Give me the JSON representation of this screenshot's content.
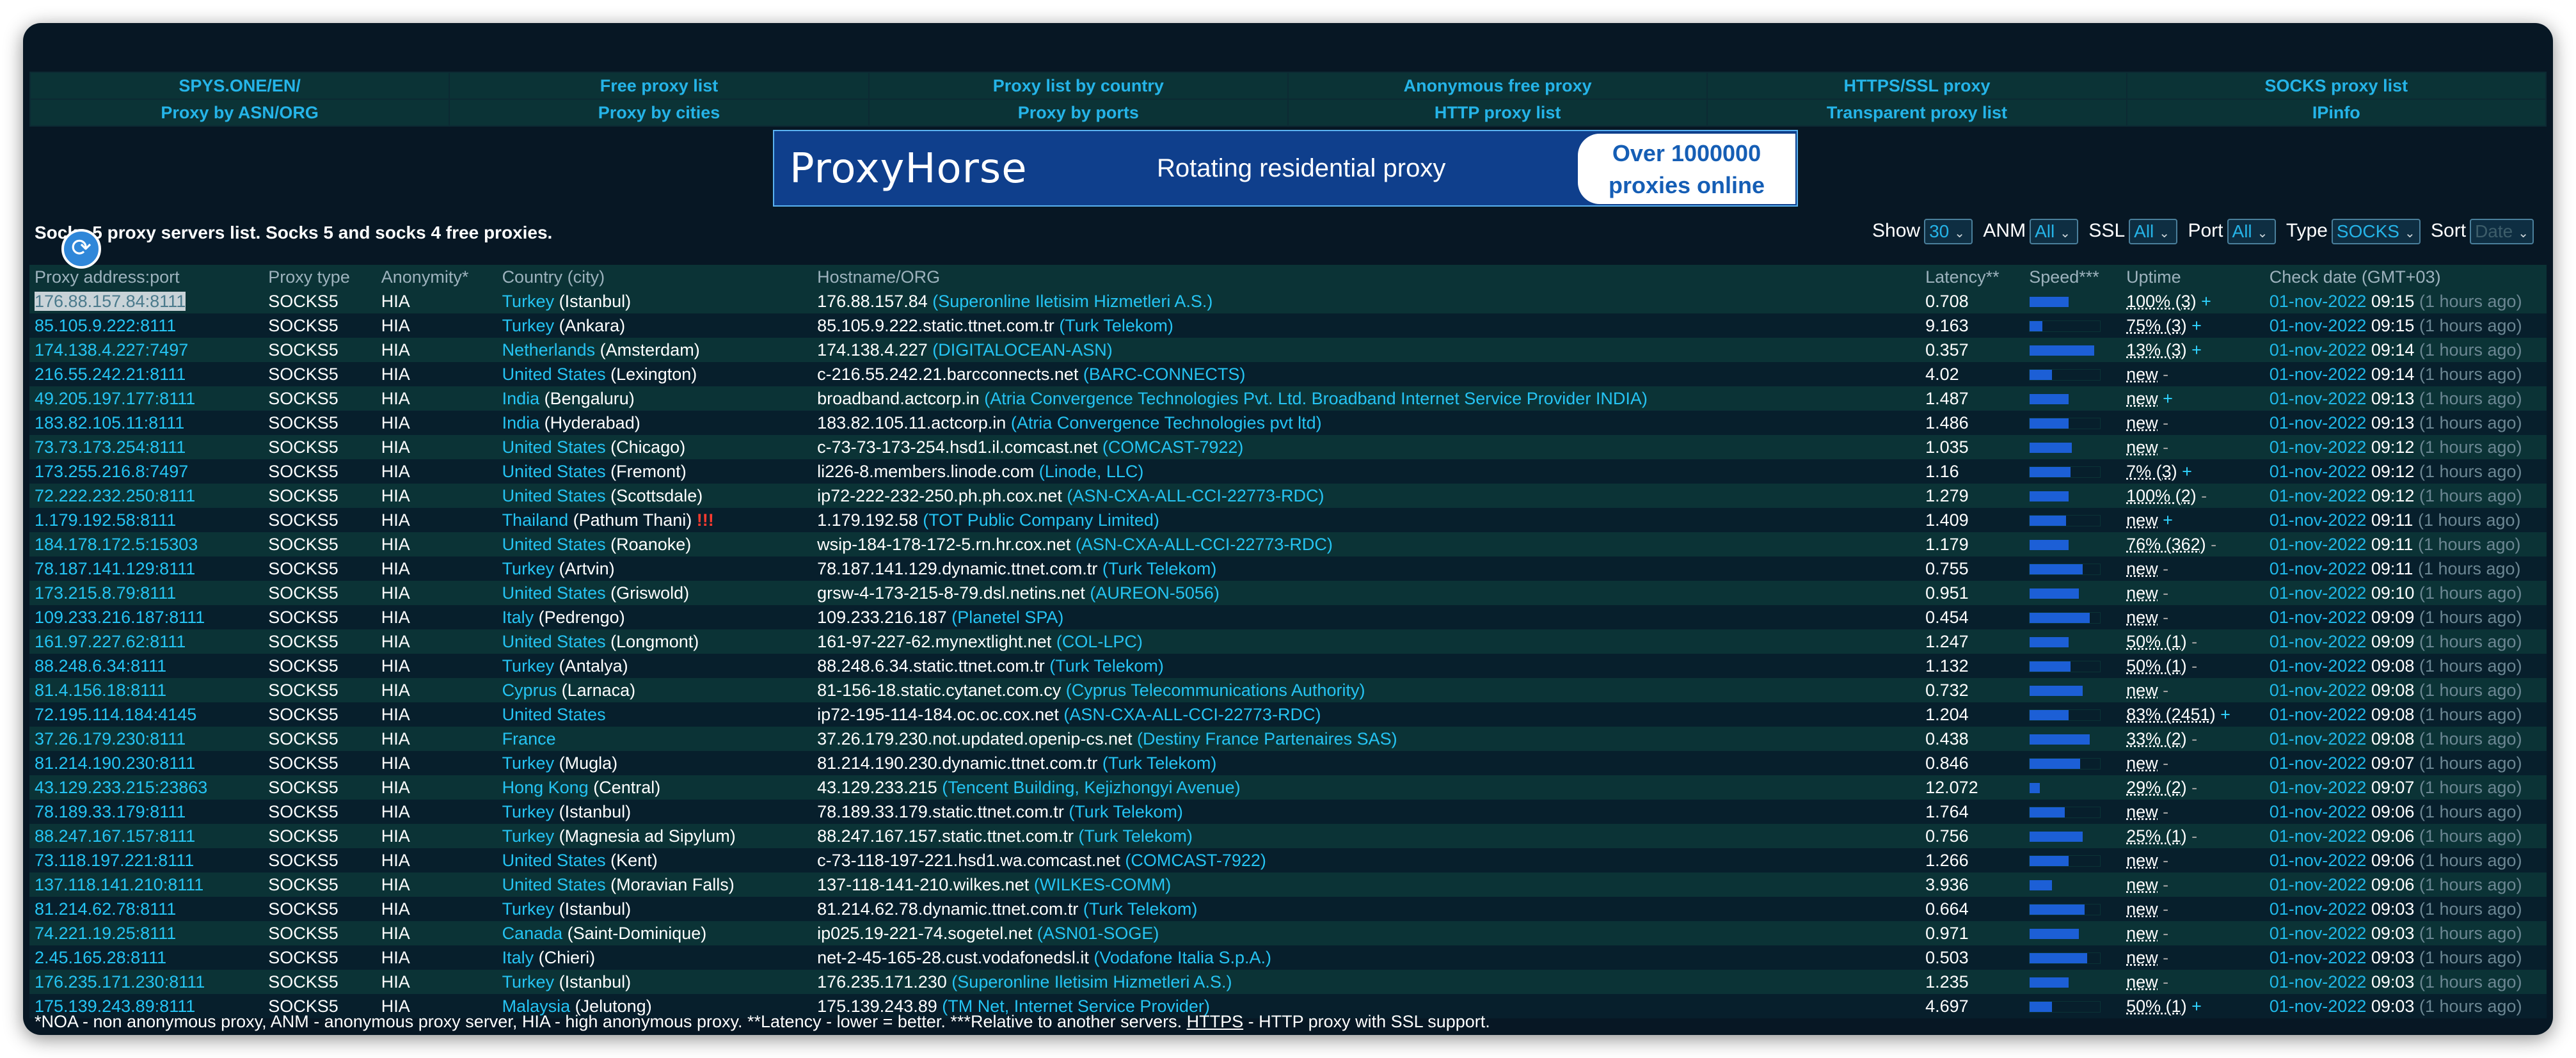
{
  "nav": {
    "row1": [
      "SPYS.ONE/EN/",
      "Free proxy list",
      "Proxy list by country",
      "Anonymous free proxy",
      "HTTPS/SSL proxy",
      "SOCKS proxy list"
    ],
    "row2": [
      "Proxy by ASN/ORG",
      "Proxy by cities",
      "Proxy by ports",
      "HTTP proxy list",
      "Transparent proxy list",
      "IPinfo"
    ]
  },
  "banner": {
    "brand": "ProxyHorse",
    "tagline": "Rotating residential proxy",
    "pill_line1": "Over 1000000",
    "pill_line2": "proxies online"
  },
  "info": {
    "title": "Socks 5 proxy servers list. Socks 5 and socks 4 free proxies."
  },
  "filters": {
    "show_label": "Show",
    "show_value": "30",
    "anm_label": "ANM",
    "anm_value": "All",
    "ssl_label": "SSL",
    "ssl_value": "All",
    "port_label": "Port",
    "port_value": "All",
    "type_label": "Type",
    "type_value": "SOCKS",
    "sort_label": "Sort",
    "sort_value": "Date"
  },
  "table": {
    "headers": [
      "Proxy address:port",
      "Proxy type",
      "Anonymity*",
      "Country (city)",
      "Hostname/ORG",
      "Latency**",
      "Speed***",
      "Uptime",
      "Check date (GMT+03)"
    ],
    "rows": [
      {
        "ip": "176.88.157.84:8111",
        "type": "SOCKS5",
        "anon": "HIA",
        "country": "Turkey",
        "city": "(Istanbul)",
        "host": "176.88.157.84",
        "org": "(Superonline Iletisim Hizmetleri A.S.)",
        "latency": "0.708",
        "speed": 0.55,
        "uptime": "100% (3)",
        "sign": "+",
        "date": "01-nov-2022",
        "time": "09:15",
        "ago": "(1 hours ago)"
      },
      {
        "ip": "85.105.9.222:8111",
        "type": "SOCKS5",
        "anon": "HIA",
        "country": "Turkey",
        "city": "(Ankara)",
        "host": "85.105.9.222.static.ttnet.com.tr",
        "org": "(Turk Telekom)",
        "latency": "9.163",
        "speed": 0.18,
        "uptime": "75% (3)",
        "sign": "+",
        "date": "01-nov-2022",
        "time": "09:15",
        "ago": "(1 hours ago)"
      },
      {
        "ip": "174.138.4.227:7497",
        "type": "SOCKS5",
        "anon": "HIA",
        "country": "Netherlands",
        "city": "(Amsterdam)",
        "host": "174.138.4.227",
        "org": "(DIGITALOCEAN-ASN)",
        "latency": "0.357",
        "speed": 0.92,
        "uptime": "13% (3)",
        "sign": "+",
        "date": "01-nov-2022",
        "time": "09:14",
        "ago": "(1 hours ago)"
      },
      {
        "ip": "216.55.242.21:8111",
        "type": "SOCKS5",
        "anon": "HIA",
        "country": "United States",
        "city": "(Lexington)",
        "host": "c-216.55.242.21.barcconnects.net",
        "org": "(BARC-CONNECTS)",
        "latency": "4.02",
        "speed": 0.32,
        "uptime": "new",
        "sign": "-",
        "date": "01-nov-2022",
        "time": "09:14",
        "ago": "(1 hours ago)"
      },
      {
        "ip": "49.205.197.177:8111",
        "type": "SOCKS5",
        "anon": "HIA",
        "country": "India",
        "city": "(Bengaluru)",
        "host": "broadband.actcorp.in",
        "org": "(Atria Convergence Technologies Pvt. Ltd. Broadband Internet Service Provider INDIA)",
        "latency": "1.487",
        "speed": 0.55,
        "uptime": "new",
        "sign": "+",
        "date": "01-nov-2022",
        "time": "09:13",
        "ago": "(1 hours ago)"
      },
      {
        "ip": "183.82.105.11:8111",
        "type": "SOCKS5",
        "anon": "HIA",
        "country": "India",
        "city": "(Hyderabad)",
        "host": "183.82.105.11.actcorp.in",
        "org": "(Atria Convergence Technologies pvt ltd)",
        "latency": "1.486",
        "speed": 0.55,
        "uptime": "new",
        "sign": "-",
        "date": "01-nov-2022",
        "time": "09:13",
        "ago": "(1 hours ago)"
      },
      {
        "ip": "73.73.173.254:8111",
        "type": "SOCKS5",
        "anon": "HIA",
        "country": "United States",
        "city": "(Chicago)",
        "host": "c-73-73-173-254.hsd1.il.comcast.net",
        "org": "(COMCAST-7922)",
        "latency": "1.035",
        "speed": 0.6,
        "uptime": "new",
        "sign": "-",
        "date": "01-nov-2022",
        "time": "09:12",
        "ago": "(1 hours ago)"
      },
      {
        "ip": "173.255.216.8:7497",
        "type": "SOCKS5",
        "anon": "HIA",
        "country": "United States",
        "city": "(Fremont)",
        "host": "li226-8.members.linode.com",
        "org": "(Linode, LLC)",
        "latency": "1.16",
        "speed": 0.58,
        "uptime": "7% (3)",
        "sign": "+",
        "date": "01-nov-2022",
        "time": "09:12",
        "ago": "(1 hours ago)"
      },
      {
        "ip": "72.222.232.250:8111",
        "type": "SOCKS5",
        "anon": "HIA",
        "country": "United States",
        "city": "(Scottsdale)",
        "host": "ip72-222-232-250.ph.ph.cox.net",
        "org": "(ASN-CXA-ALL-CCI-22773-RDC)",
        "latency": "1.279",
        "speed": 0.55,
        "uptime": "100% (2)",
        "sign": "-",
        "date": "01-nov-2022",
        "time": "09:12",
        "ago": "(1 hours ago)"
      },
      {
        "ip": "1.179.192.58:8111",
        "type": "SOCKS5",
        "anon": "HIA",
        "country": "Thailand",
        "city": "(Pathum Thani)",
        "alert": "!!!",
        "host": "1.179.192.58",
        "org": "(TOT Public Company Limited)",
        "latency": "1.409",
        "speed": 0.52,
        "uptime": "new",
        "sign": "+",
        "date": "01-nov-2022",
        "time": "09:11",
        "ago": "(1 hours ago)"
      },
      {
        "ip": "184.178.172.5:15303",
        "type": "SOCKS5",
        "anon": "HIA",
        "country": "United States",
        "city": "(Roanoke)",
        "host": "wsip-184-178-172-5.rn.hr.cox.net",
        "org": "(ASN-CXA-ALL-CCI-22773-RDC)",
        "latency": "1.179",
        "speed": 0.55,
        "uptime": "76% (362)",
        "sign": "-",
        "date": "01-nov-2022",
        "time": "09:11",
        "ago": "(1 hours ago)"
      },
      {
        "ip": "78.187.141.129:8111",
        "type": "SOCKS5",
        "anon": "HIA",
        "country": "Turkey",
        "city": "(Artvin)",
        "host": "78.187.141.129.dynamic.ttnet.com.tr",
        "org": "(Turk Telekom)",
        "latency": "0.755",
        "speed": 0.75,
        "uptime": "new",
        "sign": "-",
        "date": "01-nov-2022",
        "time": "09:11",
        "ago": "(1 hours ago)"
      },
      {
        "ip": "173.215.8.79:8111",
        "type": "SOCKS5",
        "anon": "HIA",
        "country": "United States",
        "city": "(Griswold)",
        "host": "grsw-4-173-215-8-79.dsl.netins.net",
        "org": "(AUREON-5056)",
        "latency": "0.951",
        "speed": 0.7,
        "uptime": "new",
        "sign": "-",
        "date": "01-nov-2022",
        "time": "09:10",
        "ago": "(1 hours ago)"
      },
      {
        "ip": "109.233.216.187:8111",
        "type": "SOCKS5",
        "anon": "HIA",
        "country": "Italy",
        "city": "(Pedrengo)",
        "host": "109.233.216.187",
        "org": "(Planetel SPA)",
        "latency": "0.454",
        "speed": 0.85,
        "uptime": "new",
        "sign": "-",
        "date": "01-nov-2022",
        "time": "09:09",
        "ago": "(1 hours ago)"
      },
      {
        "ip": "161.97.227.62:8111",
        "type": "SOCKS5",
        "anon": "HIA",
        "country": "United States",
        "city": "(Longmont)",
        "host": "161-97-227-62.mynextlight.net",
        "org": "(COL-LPC)",
        "latency": "1.247",
        "speed": 0.55,
        "uptime": "50% (1)",
        "sign": "-",
        "date": "01-nov-2022",
        "time": "09:09",
        "ago": "(1 hours ago)"
      },
      {
        "ip": "88.248.6.34:8111",
        "type": "SOCKS5",
        "anon": "HIA",
        "country": "Turkey",
        "city": "(Antalya)",
        "host": "88.248.6.34.static.ttnet.com.tr",
        "org": "(Turk Telekom)",
        "latency": "1.132",
        "speed": 0.58,
        "uptime": "50% (1)",
        "sign": "-",
        "date": "01-nov-2022",
        "time": "09:08",
        "ago": "(1 hours ago)"
      },
      {
        "ip": "81.4.156.18:8111",
        "type": "SOCKS5",
        "anon": "HIA",
        "country": "Cyprus",
        "city": "(Larnaca)",
        "host": "81-156-18.static.cytanet.com.cy",
        "org": "(Cyprus Telecommunications Authority)",
        "latency": "0.732",
        "speed": 0.75,
        "uptime": "new",
        "sign": "-",
        "date": "01-nov-2022",
        "time": "09:08",
        "ago": "(1 hours ago)"
      },
      {
        "ip": "72.195.114.184:4145",
        "type": "SOCKS5",
        "anon": "HIA",
        "country": "United States",
        "city": "",
        "host": "ip72-195-114-184.oc.oc.cox.net",
        "org": "(ASN-CXA-ALL-CCI-22773-RDC)",
        "latency": "1.204",
        "speed": 0.55,
        "uptime": "83% (2451)",
        "sign": "+",
        "date": "01-nov-2022",
        "time": "09:08",
        "ago": "(1 hours ago)"
      },
      {
        "ip": "37.26.179.230:8111",
        "type": "SOCKS5",
        "anon": "HIA",
        "country": "France",
        "city": "",
        "host": "37.26.179.230.not.updated.openip-cs.net",
        "org": "(Destiny France Partenaires SAS)",
        "latency": "0.438",
        "speed": 0.85,
        "uptime": "33% (2)",
        "sign": "-",
        "date": "01-nov-2022",
        "time": "09:08",
        "ago": "(1 hours ago)"
      },
      {
        "ip": "81.214.190.230:8111",
        "type": "SOCKS5",
        "anon": "HIA",
        "country": "Turkey",
        "city": "(Mugla)",
        "host": "81.214.190.230.dynamic.ttnet.com.tr",
        "org": "(Turk Telekom)",
        "latency": "0.846",
        "speed": 0.72,
        "uptime": "new",
        "sign": "-",
        "date": "01-nov-2022",
        "time": "09:07",
        "ago": "(1 hours ago)"
      },
      {
        "ip": "43.129.233.215:23863",
        "type": "SOCKS5",
        "anon": "HIA",
        "country": "Hong Kong",
        "city": "(Central)",
        "host": "43.129.233.215",
        "org": "(Tencent Building, Kejizhongyi Avenue)",
        "latency": "12.072",
        "speed": 0.14,
        "uptime": "29% (2)",
        "sign": "-",
        "date": "01-nov-2022",
        "time": "09:07",
        "ago": "(1 hours ago)"
      },
      {
        "ip": "78.189.33.179:8111",
        "type": "SOCKS5",
        "anon": "HIA",
        "country": "Turkey",
        "city": "(Istanbul)",
        "host": "78.189.33.179.static.ttnet.com.tr",
        "org": "(Turk Telekom)",
        "latency": "1.764",
        "speed": 0.5,
        "uptime": "new",
        "sign": "-",
        "date": "01-nov-2022",
        "time": "09:06",
        "ago": "(1 hours ago)"
      },
      {
        "ip": "88.247.167.157:8111",
        "type": "SOCKS5",
        "anon": "HIA",
        "country": "Turkey",
        "city": "(Magnesia ad Sipylum)",
        "host": "88.247.167.157.static.ttnet.com.tr",
        "org": "(Turk Telekom)",
        "latency": "0.756",
        "speed": 0.75,
        "uptime": "25% (1)",
        "sign": "-",
        "date": "01-nov-2022",
        "time": "09:06",
        "ago": "(1 hours ago)"
      },
      {
        "ip": "73.118.197.221:8111",
        "type": "SOCKS5",
        "anon": "HIA",
        "country": "United States",
        "city": "(Kent)",
        "host": "c-73-118-197-221.hsd1.wa.comcast.net",
        "org": "(COMCAST-7922)",
        "latency": "1.266",
        "speed": 0.55,
        "uptime": "new",
        "sign": "-",
        "date": "01-nov-2022",
        "time": "09:06",
        "ago": "(1 hours ago)"
      },
      {
        "ip": "137.118.141.210:8111",
        "type": "SOCKS5",
        "anon": "HIA",
        "country": "United States",
        "city": "(Moravian Falls)",
        "host": "137-118-141-210.wilkes.net",
        "org": "(WILKES-COMM)",
        "latency": "3.936",
        "speed": 0.32,
        "uptime": "new",
        "sign": "-",
        "date": "01-nov-2022",
        "time": "09:06",
        "ago": "(1 hours ago)"
      },
      {
        "ip": "81.214.62.78:8111",
        "type": "SOCKS5",
        "anon": "HIA",
        "country": "Turkey",
        "city": "(Istanbul)",
        "host": "81.214.62.78.dynamic.ttnet.com.tr",
        "org": "(Turk Telekom)",
        "latency": "0.664",
        "speed": 0.78,
        "uptime": "new",
        "sign": "-",
        "date": "01-nov-2022",
        "time": "09:03",
        "ago": "(1 hours ago)"
      },
      {
        "ip": "74.221.19.25:8111",
        "type": "SOCKS5",
        "anon": "HIA",
        "country": "Canada",
        "city": "(Saint-Dominique)",
        "host": "ip025.19-221-74.sogetel.net",
        "org": "(ASN01-SOGE)",
        "latency": "0.971",
        "speed": 0.7,
        "uptime": "new",
        "sign": "-",
        "date": "01-nov-2022",
        "time": "09:03",
        "ago": "(1 hours ago)"
      },
      {
        "ip": "2.45.165.28:8111",
        "type": "SOCKS5",
        "anon": "HIA",
        "country": "Italy",
        "city": "(Chieri)",
        "host": "net-2-45-165-28.cust.vodafonedsl.it",
        "org": "(Vodafone Italia S.p.A.)",
        "latency": "0.503",
        "speed": 0.82,
        "uptime": "new",
        "sign": "-",
        "date": "01-nov-2022",
        "time": "09:03",
        "ago": "(1 hours ago)"
      },
      {
        "ip": "176.235.171.230:8111",
        "type": "SOCKS5",
        "anon": "HIA",
        "country": "Turkey",
        "city": "(Istanbul)",
        "host": "176.235.171.230",
        "org": "(Superonline Iletisim Hizmetleri A.S.)",
        "latency": "1.235",
        "speed": 0.55,
        "uptime": "new",
        "sign": "-",
        "date": "01-nov-2022",
        "time": "09:03",
        "ago": "(1 hours ago)"
      },
      {
        "ip": "175.139.243.89:8111",
        "type": "SOCKS5",
        "anon": "HIA",
        "country": "Malaysia",
        "city": "(Jelutong)",
        "host": "175.139.243.89",
        "org": "(TM Net, Internet Service Provider)",
        "latency": "4.697",
        "speed": 0.32,
        "uptime": "50% (1)",
        "sign": "+",
        "date": "01-nov-2022",
        "time": "09:03",
        "ago": "(1 hours ago)"
      }
    ]
  },
  "footnote": {
    "part1": "*NOA - non anonymous proxy, ANM - anonymous proxy server, HIA - high anonymous proxy. **Latency - lower = better. ***Relative to another servers. ",
    "link": "HTTPS",
    "part2": " - HTTP proxy with SSL support."
  },
  "colors": {
    "background": "#071724",
    "row_alt": "#0b3336",
    "link": "#25b4e8",
    "speed_bar": "#1c5fd6"
  }
}
